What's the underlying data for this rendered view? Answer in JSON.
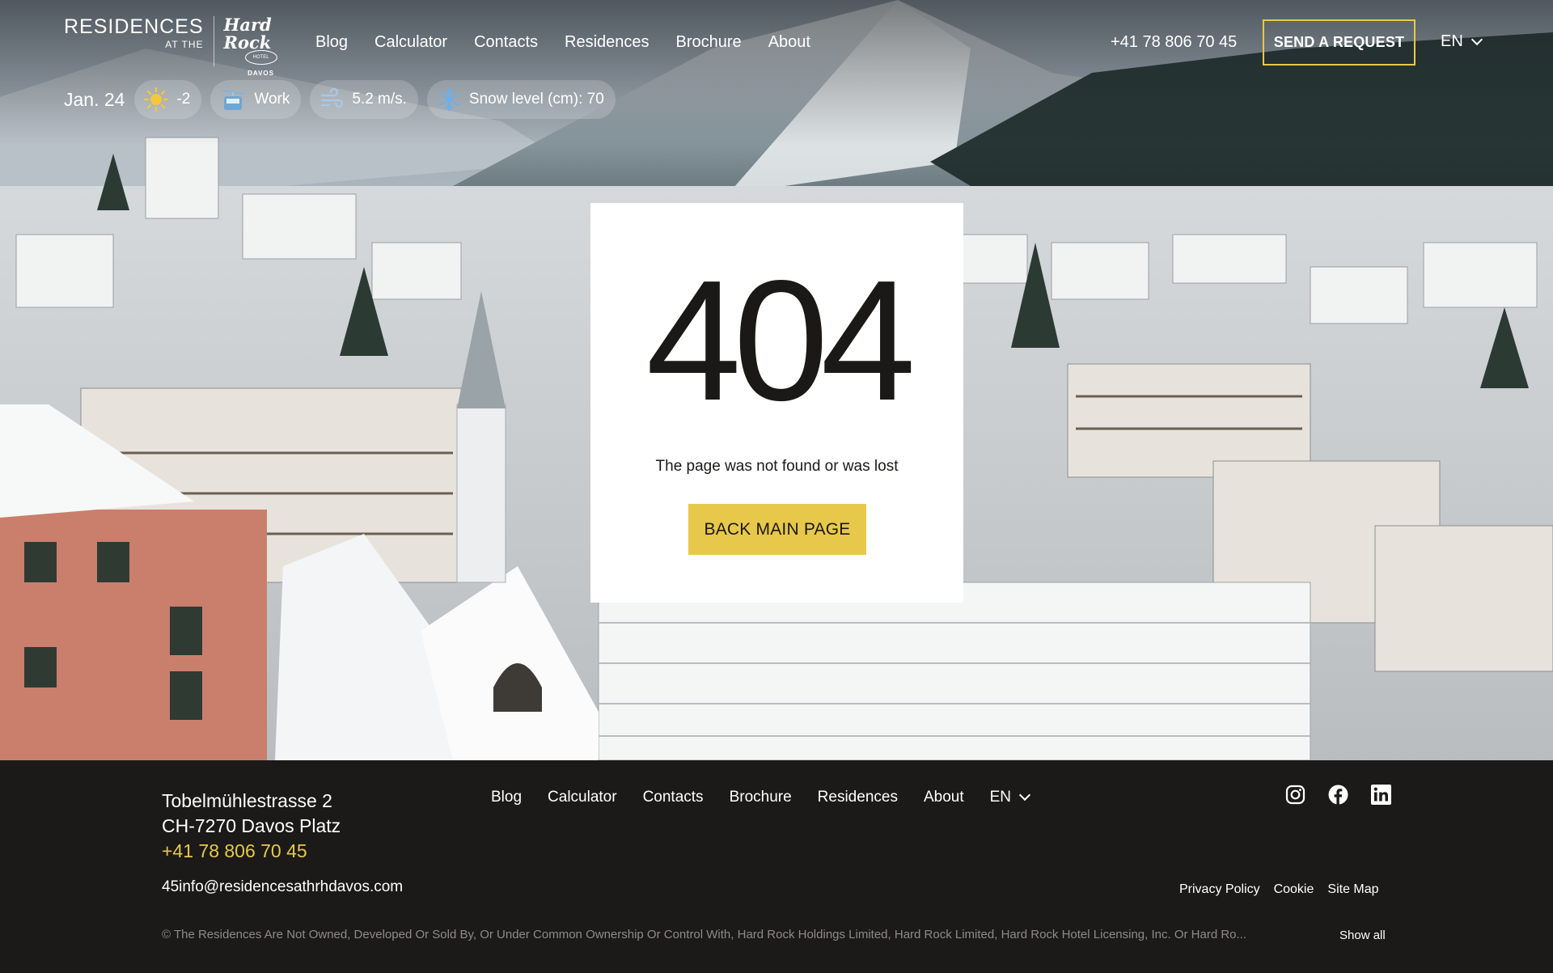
{
  "header": {
    "logo": {
      "residences": "RESIDENCES",
      "at_the": "AT THE",
      "hard_rock": "Hard Rock",
      "hotel": "HOTEL",
      "davos": "DAVOS"
    },
    "nav": [
      "Blog",
      "Calculator",
      "Contacts",
      "Residences",
      "Brochure",
      "About"
    ],
    "phone": "+41 78 806 70 45",
    "request_button": "SEND A REQUEST",
    "language": "EN"
  },
  "weather": {
    "date": "Jan. 24",
    "temperature": "-2",
    "lift_status": "Work",
    "wind": "5.2 m/s.",
    "snow": "Snow level (cm): 70"
  },
  "error": {
    "code": "404",
    "message": "The page was not found or was lost",
    "button": "BACK MAIN PAGE"
  },
  "footer": {
    "address_line1": "Tobelmühlestrasse 2",
    "address_line2": "CH-7270 Davos Platz",
    "phone": "+41 78 806 70 45",
    "email": "45info@residencesathrhdavos.com",
    "nav": [
      "Blog",
      "Calculator",
      "Contacts",
      "Brochure",
      "Residences",
      "About"
    ],
    "language": "EN",
    "legal": [
      "Privacy Policy",
      "Cookie",
      "Site Map"
    ],
    "copyright": "© The Residences Are Not Owned, Developed Or Sold By, Or Under Common Ownership Or Control With, Hard Rock Holdings Limited, Hard Rock Limited, Hard Rock Hotel Licensing, Inc. Or Hard Ro...",
    "show_all": "Show all",
    "social_icons": [
      "instagram-icon",
      "facebook-icon",
      "linkedin-icon"
    ]
  },
  "colors": {
    "accent": "#e8c84a",
    "footer_bg": "#1b1a19",
    "card_bg": "#ffffff"
  }
}
